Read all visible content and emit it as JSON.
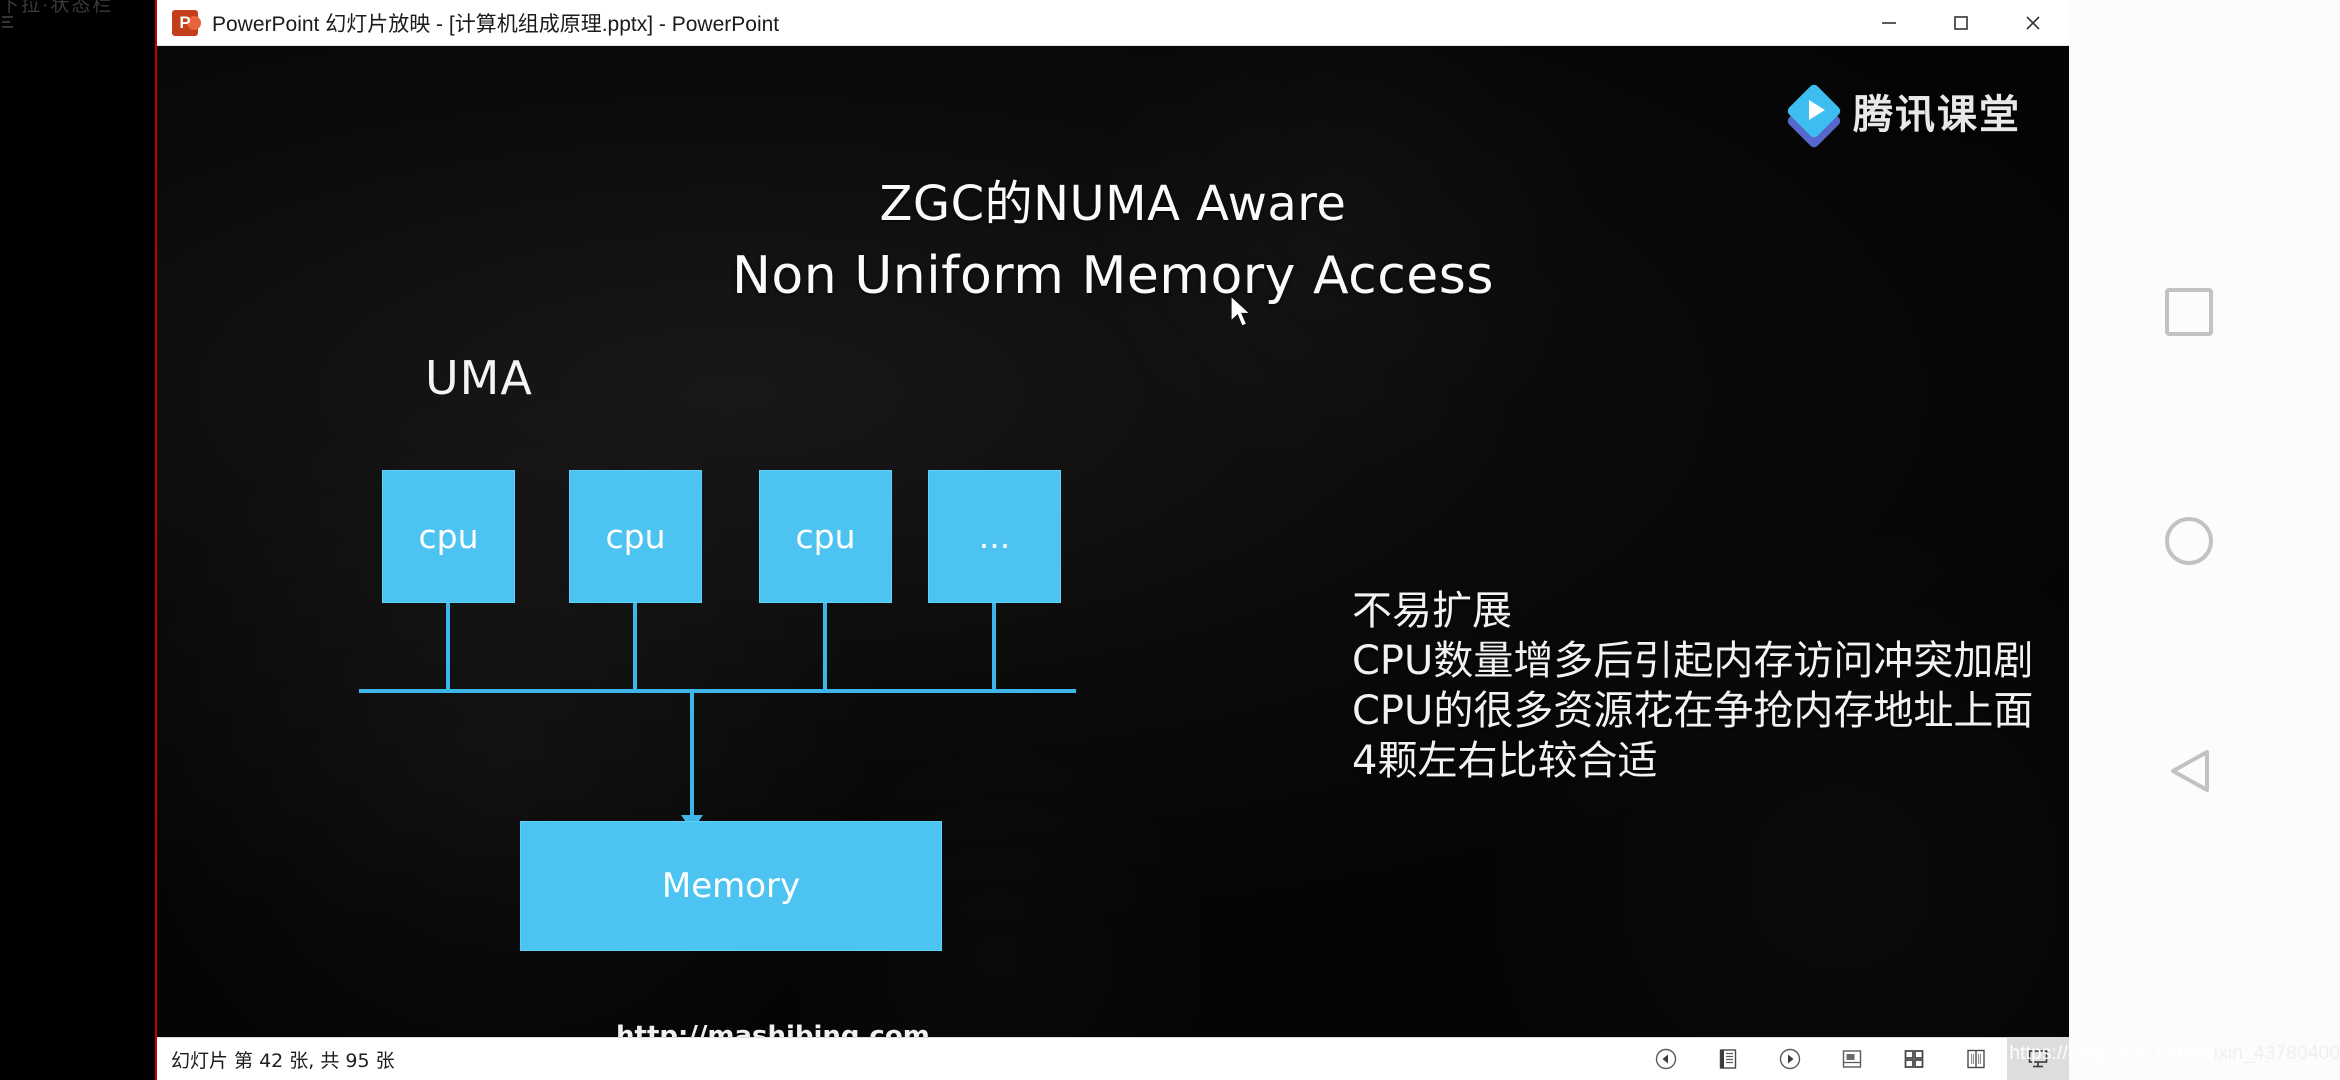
{
  "window": {
    "app_icon": "powerpoint-icon",
    "title": "PowerPoint 幻灯片放映 - [计算机组成原理.pptx] - PowerPoint",
    "minimize_label": "minimize",
    "maximize_label": "maximize",
    "close_label": "close"
  },
  "ghost_text": "下拉·状态栏",
  "brand": {
    "name": "腾讯课堂",
    "mark": "play-diamond-icon"
  },
  "slide": {
    "title_line1": "ZGC的NUMA Aware",
    "title_line2": "Non Uniform Memory Access",
    "section_label": "UMA",
    "cpu_boxes": [
      {
        "label": "cpu"
      },
      {
        "label": "cpu"
      },
      {
        "label": "cpu"
      },
      {
        "label": "..."
      }
    ],
    "memory_box": {
      "label": "Memory"
    },
    "bullets": [
      "不易扩展",
      "CPU数量增多后引起内存访问冲突加剧",
      "CPU的很多资源花在争抢内存地址上面",
      "4颗左右比较合适"
    ],
    "footer_url": "http://mashibing.com",
    "accent_color": "#4cc3f0",
    "line_color": "#3fb6ea",
    "text_color": "#f4f4f4",
    "background_color": "#060606"
  },
  "statusbar": {
    "slide_text": "幻灯片 第 42 张, 共 95 张",
    "tools": [
      {
        "name": "previous-slide-button",
        "icon": "chevron-left-circle-icon",
        "active": false
      },
      {
        "name": "pen-tools-button",
        "icon": "pen-menu-icon",
        "active": false
      },
      {
        "name": "next-slide-button",
        "icon": "chevron-right-circle-icon",
        "active": false
      },
      {
        "name": "zoom-button",
        "icon": "magnify-slide-icon",
        "active": false
      },
      {
        "name": "all-slides-button",
        "icon": "grid-icon",
        "active": false
      },
      {
        "name": "reading-view-button",
        "icon": "book-icon",
        "active": false
      },
      {
        "name": "presenter-view-button",
        "icon": "projector-icon",
        "active": true
      }
    ]
  },
  "watermark": {
    "text": "https://blog.csdn.net/we",
    "dim_text": "ixin_43780400"
  },
  "nav_rail": {
    "recents_label": "recents",
    "home_label": "home",
    "back_label": "back"
  }
}
